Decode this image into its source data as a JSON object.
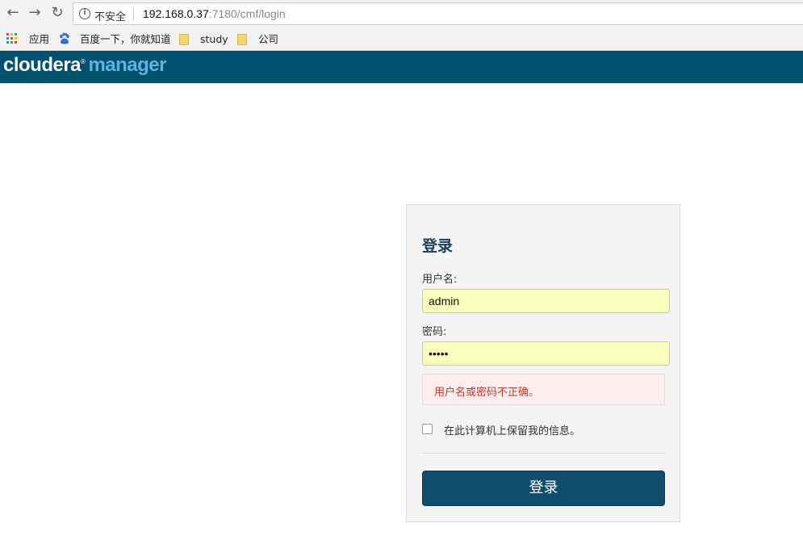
{
  "browser": {
    "security_label": "不安全",
    "url_host": "192.168.0.37",
    "url_rest": ":7180/cmf/login",
    "bookmarks": [
      {
        "label": "应用",
        "icon": "apps-grid-icon"
      },
      {
        "label": "百度一下，你就知道",
        "icon": "baidu-paw-icon"
      },
      {
        "label": "study",
        "icon": "folder-icon"
      },
      {
        "label": "公司",
        "icon": "folder-icon"
      }
    ]
  },
  "header": {
    "brand_primary": "cloudera",
    "brand_secondary": "manager",
    "background_color": "#00506e"
  },
  "login": {
    "title": "登录",
    "username_label": "用户名:",
    "username_value": "admin",
    "password_label": "密码:",
    "password_value": "admin",
    "error_message": "用户名或密码不正确。",
    "remember_label": "在此计算机上保留我的信息。",
    "remember_checked": false,
    "submit_label": "登录"
  }
}
